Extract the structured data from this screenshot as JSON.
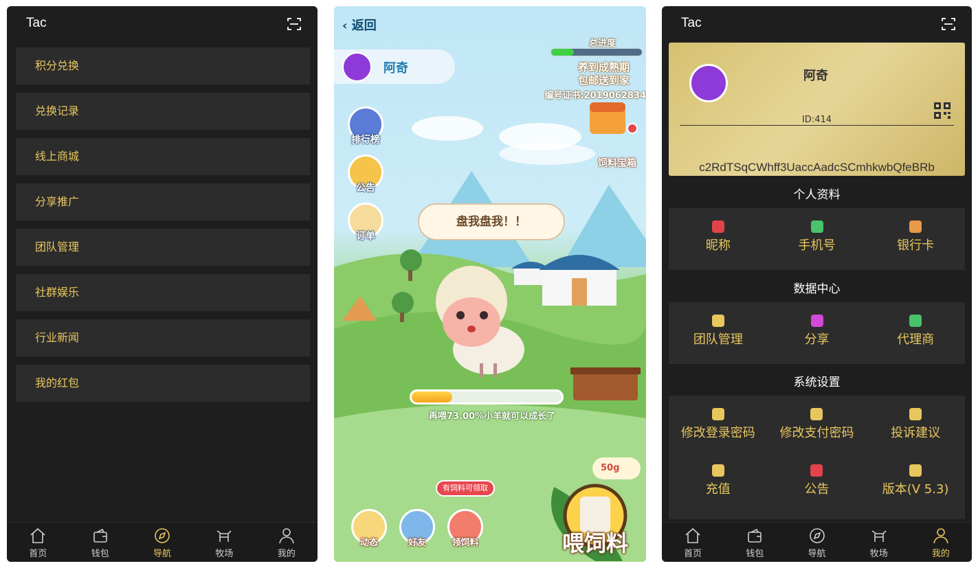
{
  "left": {
    "title": "Tac",
    "menu": [
      "积分兑换",
      "兑换记录",
      "线上商城",
      "分享推广",
      "团队管理",
      "社群娱乐",
      "行业新闻",
      "我的红包"
    ],
    "tabs": [
      {
        "label": "首页",
        "icon": "home-icon"
      },
      {
        "label": "钱包",
        "icon": "wallet-icon"
      },
      {
        "label": "导航",
        "icon": "compass-icon",
        "active": true
      },
      {
        "label": "牧场",
        "icon": "ranch-icon"
      },
      {
        "label": "我的",
        "icon": "user-icon"
      }
    ]
  },
  "game": {
    "back_label": "返回",
    "user_name": "阿奇",
    "progress_title": "总进度",
    "progress_fraction": 0.25,
    "banner_line1": "养到成熟期",
    "banner_line2": "包邮送到家",
    "cert_text": "编号证书:2019062834",
    "side_buttons": [
      "排行榜",
      "公告",
      "订单"
    ],
    "treasure_label": "饲料宝箱",
    "speech": "盘我盘我！！",
    "feed_progress": 0.27,
    "feed_text": "再喂73.00%小羊就可以成长了",
    "hint_text": "有饲料可领取",
    "bottom_buttons": [
      "动态",
      "好友",
      "领饲料"
    ],
    "feed_amount": "50g",
    "feed_button": "喂饲料"
  },
  "profile": {
    "title": "Tac",
    "name": "阿奇",
    "id_text": "ID:414",
    "code": "c2RdTSqCWhff3UaccAadcSCmhkwbQfeBRb",
    "sections": [
      {
        "title": "个人资料",
        "items": [
          {
            "label": "昵称",
            "icon": "id-card-icon",
            "color": "#e2434b"
          },
          {
            "label": "手机号",
            "icon": "phone-icon",
            "color": "#48c36b"
          },
          {
            "label": "银行卡",
            "icon": "wallet-card-icon",
            "color": "#e9994a"
          }
        ]
      },
      {
        "title": "数据中心",
        "items": [
          {
            "label": "团队管理",
            "icon": "crown-icon",
            "color": "#e8c65e"
          },
          {
            "label": "分享",
            "icon": "share-icon",
            "color": "#d24ad6"
          },
          {
            "label": "代理商",
            "icon": "agent-icon",
            "color": "#48c36b"
          }
        ]
      },
      {
        "title": "系统设置",
        "items": [
          {
            "label": "修改登录密码",
            "icon": "shield-icon",
            "color": "#e8c65e"
          },
          {
            "label": "修改支付密码",
            "icon": "lock-icon",
            "color": "#e8c65e"
          },
          {
            "label": "投诉建议",
            "icon": "edit-icon",
            "color": "#e8c65e"
          },
          {
            "label": "充值",
            "icon": "recharge-icon",
            "color": "#e8c65e"
          },
          {
            "label": "公告",
            "icon": "speaker-icon",
            "color": "#e2434b"
          },
          {
            "label": "版本(V 5.3)",
            "icon": "version-icon",
            "color": "#e8c65e"
          }
        ]
      }
    ],
    "tabs": [
      {
        "label": "首页",
        "icon": "home-icon"
      },
      {
        "label": "钱包",
        "icon": "wallet-icon"
      },
      {
        "label": "导航",
        "icon": "compass-icon"
      },
      {
        "label": "牧场",
        "icon": "ranch-icon"
      },
      {
        "label": "我的",
        "icon": "user-icon",
        "active": true
      }
    ]
  }
}
